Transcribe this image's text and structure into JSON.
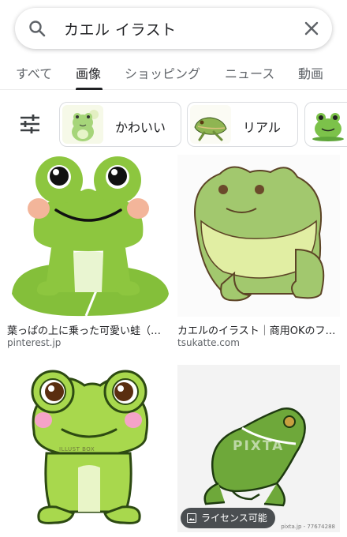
{
  "search": {
    "query": "カエル イラスト"
  },
  "tabs": [
    {
      "label": "すべて"
    },
    {
      "label": "画像"
    },
    {
      "label": "ショッピング"
    },
    {
      "label": "ニュース"
    },
    {
      "label": "動画"
    }
  ],
  "active_tab": "画像",
  "chips": [
    {
      "label": "かわいい"
    },
    {
      "label": "リアル"
    }
  ],
  "results": [
    {
      "title": "葉っぱの上に乗った可愛い蛙（イラスト）",
      "source": "pinterest.jp"
    },
    {
      "title": "カエルのイラスト｜商用OKのフリー素材",
      "source": "tsukatte.com"
    },
    {
      "title": "",
      "source": "",
      "watermark": "ILLUST BOX"
    },
    {
      "title": "",
      "source": "",
      "watermark": "PIXTA",
      "badge": "ライセンス可能",
      "credit": "pixta.jp - 77674288"
    }
  ],
  "colors": {
    "frog_green": "#8dc63f",
    "dark_text": "#202124",
    "grey_text": "#5f6368"
  }
}
